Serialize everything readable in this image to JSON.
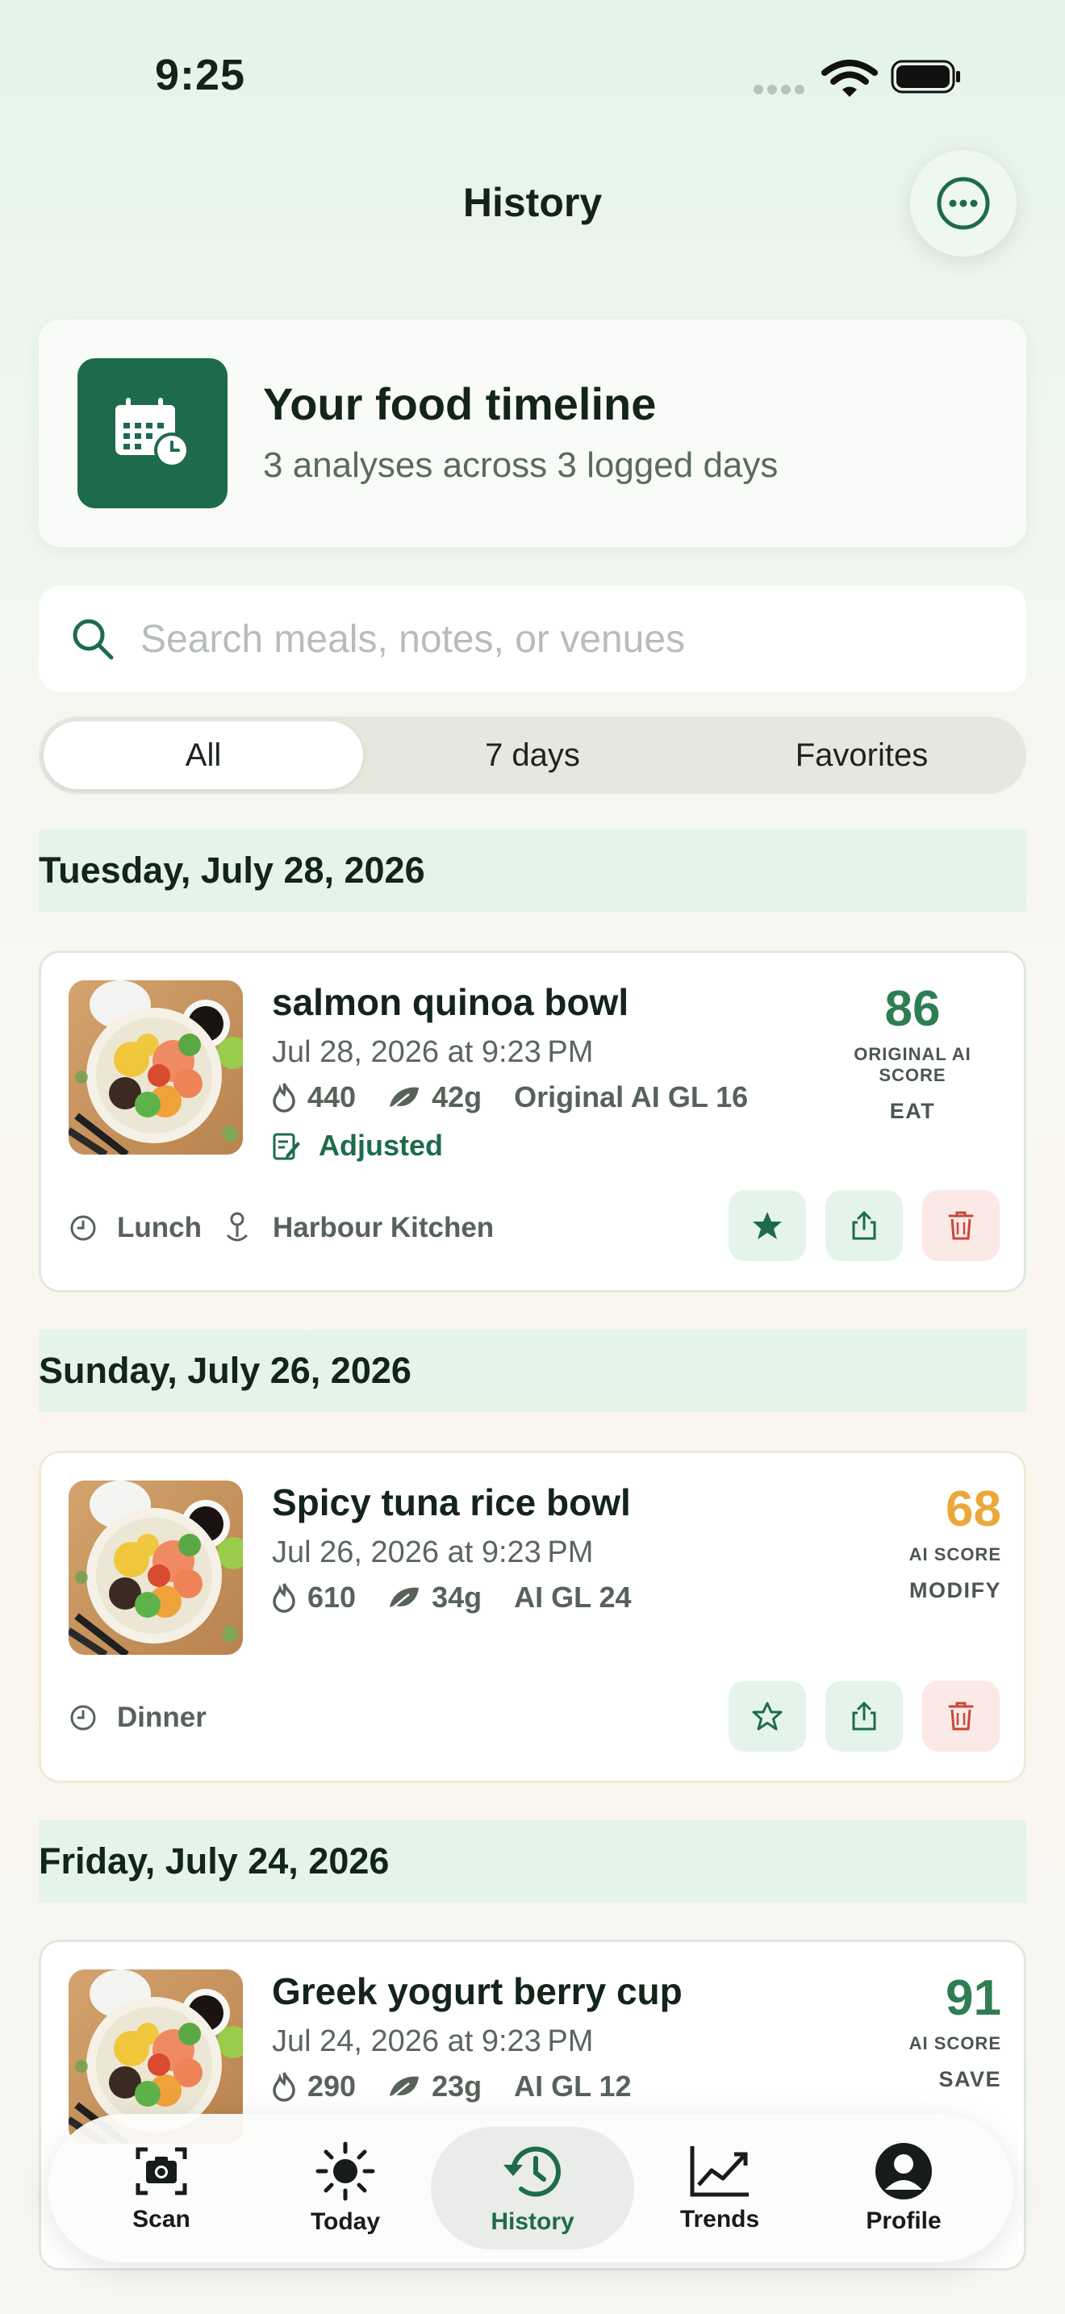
{
  "status_bar": {
    "time": "9:25"
  },
  "header": {
    "title": "History"
  },
  "timeline": {
    "title": "Your food timeline",
    "subtitle": "3 analyses across 3 logged days"
  },
  "search": {
    "placeholder": "Search meals, notes, or venues"
  },
  "filters": [
    "All",
    "7 days",
    "Favorites"
  ],
  "filter_selected": "All",
  "days": [
    {
      "label": "Tuesday, July 28, 2026",
      "meal": {
        "name": "salmon quinoa bowl",
        "date": "Jul 28, 2026 at 9:23 PM",
        "calories": "440",
        "protein": "42g",
        "gl": "Original AI GL 16",
        "adjusted": "Adjusted",
        "score": "86",
        "score_label": "ORIGINAL AI SCORE",
        "verdict": "EAT",
        "score_color": "#2f7d52",
        "meal_type": "Lunch",
        "venue": "Harbour Kitchen",
        "favorite": true
      }
    },
    {
      "label": "Sunday, July 26, 2026",
      "meal": {
        "name": "Spicy tuna rice bowl",
        "date": "Jul 26, 2026 at 9:23 PM",
        "calories": "610",
        "protein": "34g",
        "gl": "AI GL 24",
        "score": "68",
        "score_label": "AI SCORE",
        "verdict": "MODIFY",
        "score_color": "#eba83a",
        "meal_type": "Dinner",
        "favorite": false
      }
    },
    {
      "label": "Friday, July 24, 2026",
      "meal": {
        "name": "Greek yogurt berry cup",
        "date": "Jul 24, 2026 at 9:23 PM",
        "calories": "290",
        "protein": "23g",
        "gl": "AI GL 12",
        "score": "91",
        "score_label": "AI SCORE",
        "verdict": "SAVE",
        "score_color": "#2f7d52"
      }
    }
  ],
  "tabbar": {
    "items": [
      "Scan",
      "Today",
      "History",
      "Trends",
      "Profile"
    ],
    "active": "History"
  },
  "colors": {
    "brand": "#1e6b4c",
    "delete": "#c9473b"
  },
  "icons": {
    "flame": "flame-icon",
    "leaf": "leaf-icon",
    "clock": "clock-icon",
    "location": "location-pin-icon",
    "star": "star-icon",
    "share": "share-icon",
    "trash": "trash-icon"
  }
}
